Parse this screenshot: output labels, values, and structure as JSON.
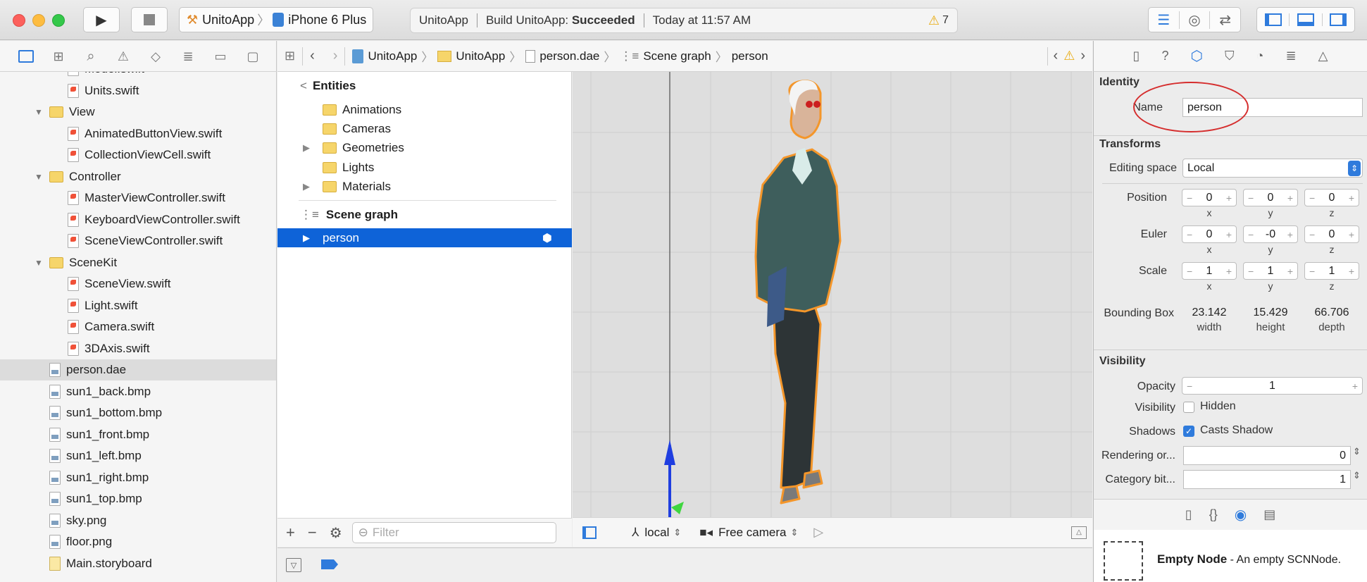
{
  "toolbar": {
    "scheme_app": "UnitoApp",
    "scheme_device": "iPhone 6 Plus",
    "activity_app": "UnitoApp",
    "activity_build_prefix": "Build UnitoApp: ",
    "activity_build_status": "Succeeded",
    "activity_time": "Today at 11:57 AM",
    "warning_count": "7"
  },
  "navigator": {
    "items": [
      {
        "label": "Model.swift",
        "type": "swift"
      },
      {
        "label": "Units.swift",
        "type": "swift"
      },
      {
        "label": "View",
        "type": "folder"
      },
      {
        "label": "AnimatedButtonView.swift",
        "type": "swift"
      },
      {
        "label": "CollectionViewCell.swift",
        "type": "swift"
      },
      {
        "label": "Controller",
        "type": "folder"
      },
      {
        "label": "MasterViewController.swift",
        "type": "swift"
      },
      {
        "label": "KeyboardViewController.swift",
        "type": "swift"
      },
      {
        "label": "SceneViewController.swift",
        "type": "swift"
      },
      {
        "label": "SceneKit",
        "type": "folder"
      },
      {
        "label": "SceneView.swift",
        "type": "swift"
      },
      {
        "label": "Light.swift",
        "type": "swift"
      },
      {
        "label": "Camera.swift",
        "type": "swift"
      },
      {
        "label": "3DAxis.swift",
        "type": "swift"
      },
      {
        "label": "person.dae",
        "type": "dae"
      },
      {
        "label": "sun1_back.bmp",
        "type": "img"
      },
      {
        "label": "sun1_bottom.bmp",
        "type": "img"
      },
      {
        "label": "sun1_front.bmp",
        "type": "img"
      },
      {
        "label": "sun1_left.bmp",
        "type": "img"
      },
      {
        "label": "sun1_right.bmp",
        "type": "img"
      },
      {
        "label": "sun1_top.bmp",
        "type": "img"
      },
      {
        "label": "sky.png",
        "type": "img"
      },
      {
        "label": "floor.png",
        "type": "img"
      },
      {
        "label": "Main.storyboard",
        "type": "sb"
      }
    ]
  },
  "jumpbar": {
    "crumbs": [
      "UnitoApp",
      "UnitoApp",
      "person.dae",
      "Scene graph",
      "person"
    ]
  },
  "outline": {
    "entities_header": "Entities",
    "entities": [
      "Animations",
      "Cameras",
      "Geometries",
      "Lights",
      "Materials"
    ],
    "scene_graph_header": "Scene graph",
    "selected_node": "person",
    "filter_placeholder": "Filter"
  },
  "viewport_bar": {
    "space": "local",
    "camera": "Free camera"
  },
  "inspector": {
    "identity_header": "Identity",
    "name_label": "Name",
    "name_value": "person",
    "transforms_header": "Transforms",
    "editing_space_label": "Editing space",
    "editing_space_value": "Local",
    "position_label": "Position",
    "position": [
      "0",
      "0",
      "0"
    ],
    "euler_label": "Euler",
    "euler": [
      "0",
      "-0",
      "0"
    ],
    "scale_label": "Scale",
    "scale": [
      "1",
      "1",
      "1"
    ],
    "axes": [
      "x",
      "y",
      "z"
    ],
    "bbox_label": "Bounding Box",
    "bbox_values": [
      "23.142",
      "15.429",
      "66.706"
    ],
    "bbox_captions": [
      "width",
      "height",
      "depth"
    ],
    "visibility_header": "Visibility",
    "opacity_label": "Opacity",
    "opacity_value": "1",
    "visibility_label": "Visibility",
    "hidden_label": "Hidden",
    "shadows_label": "Shadows",
    "casts_shadow_label": "Casts Shadow",
    "rendering_label": "Rendering or...",
    "rendering_value": "0",
    "category_label": "Category bit...",
    "category_value": "1"
  },
  "library": {
    "title": "Empty Node",
    "description": " - An empty SCNNode."
  }
}
